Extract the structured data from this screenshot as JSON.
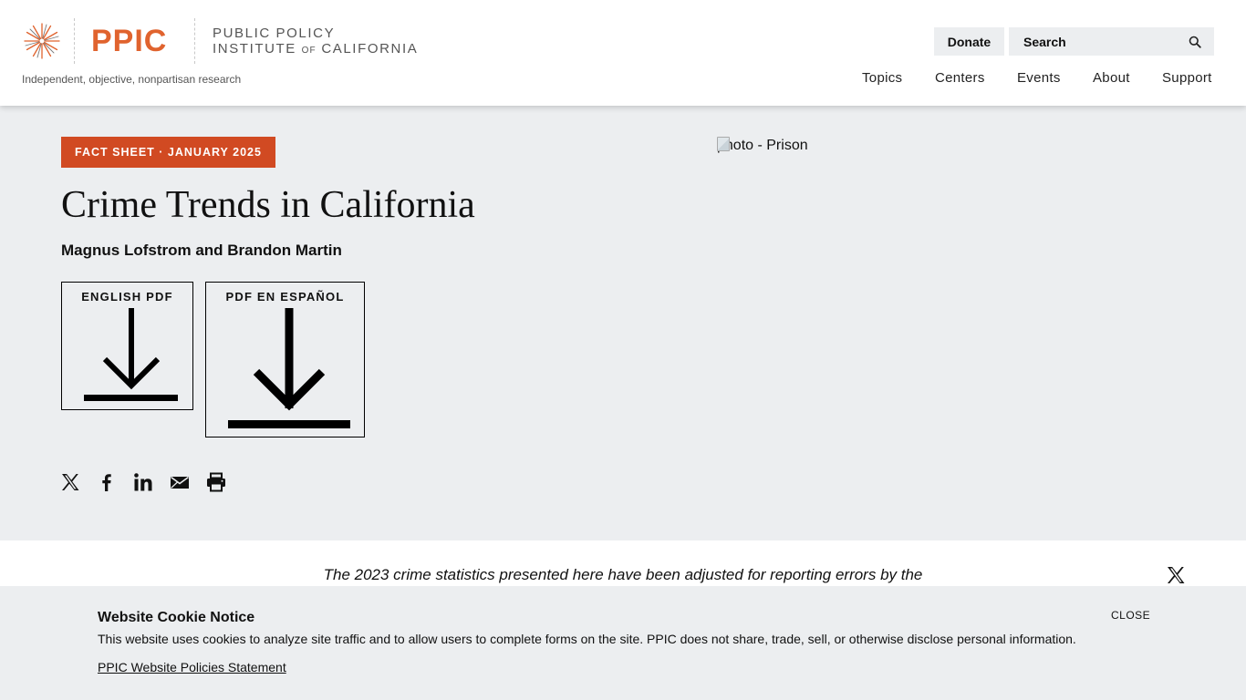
{
  "header": {
    "logo_text": "PPIC",
    "logo_name_line1": "PUBLIC POLICY",
    "logo_name_line2_a": "INSTITUTE ",
    "logo_name_line2_of": "OF",
    "logo_name_line2_b": " CALIFORNIA",
    "tagline": "Independent, objective, nonpartisan research",
    "donate_label": "Donate",
    "search_placeholder": "Search",
    "nav": [
      "Topics",
      "Centers",
      "Events",
      "About",
      "Support"
    ],
    "colors": {
      "brand": "#e0632e"
    }
  },
  "hero": {
    "badge": "FACT SHEET · JANUARY 2025",
    "title": "Crime Trends in California",
    "authors": "Magnus Lofstrom and Brandon Martin",
    "pdf_buttons": [
      {
        "label": "ENGLISH PDF",
        "icon": "download-icon"
      },
      {
        "label": "PDF EN ESPAÑOL",
        "icon": "download-icon"
      }
    ],
    "share_icons": [
      "x-icon",
      "facebook-icon",
      "linkedin-icon",
      "email-icon",
      "print-icon"
    ],
    "image_alt": "photo - Prison",
    "colors": {
      "badge": "#d14a22",
      "background": "#eceef0"
    }
  },
  "notice": {
    "text": "The 2023 crime statistics presented here have been adjusted for reporting errors by the"
  },
  "cookie": {
    "title": "Website Cookie Notice",
    "body": "This website uses cookies to analyze site traffic and to allow users to complete forms on the site. PPIC does not share, trade, sell, or otherwise disclose personal information.",
    "link": "PPIC Website Policies Statement",
    "close_label": "CLOSE"
  }
}
